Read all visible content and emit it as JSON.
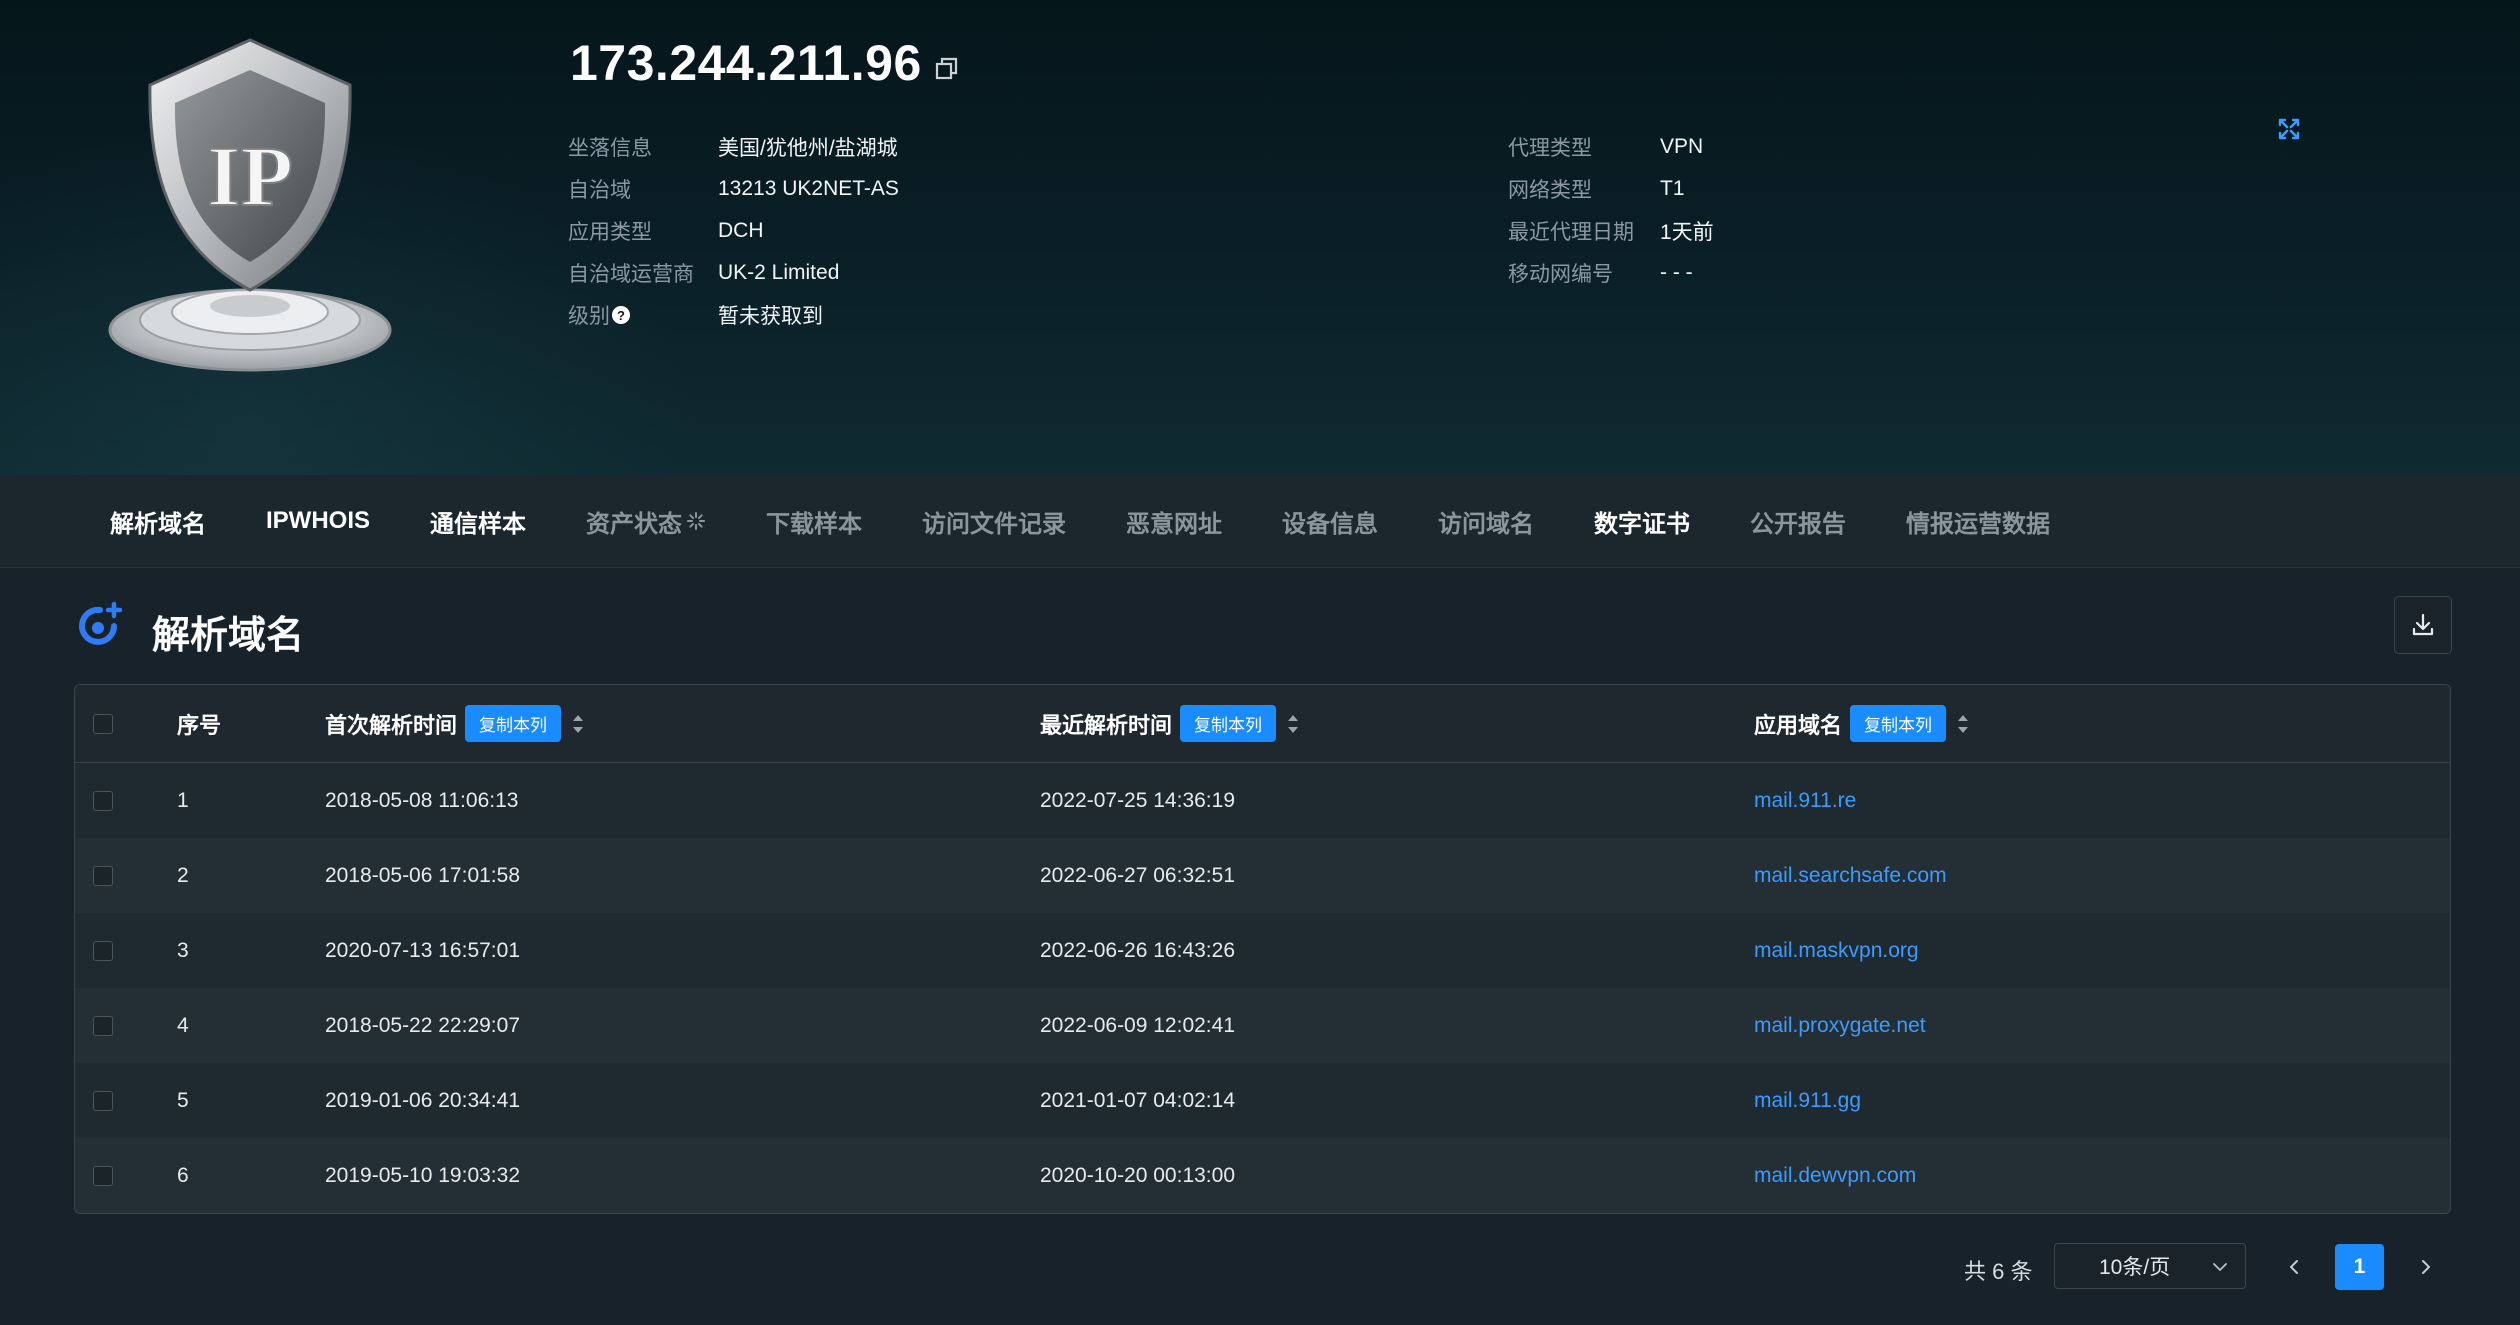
{
  "header": {
    "ip": "173.244.211.96",
    "logo_text": "IP",
    "left_info": [
      {
        "label": "坐落信息",
        "value": "美国/犹他州/盐湖城"
      },
      {
        "label": "自治域",
        "value": "13213 UK2NET-AS"
      },
      {
        "label": "应用类型",
        "value": "DCH"
      },
      {
        "label": "自治域运营商",
        "value": "UK-2 Limited"
      },
      {
        "label": "级别",
        "value": "暂未获取到"
      }
    ],
    "right_info": [
      {
        "label": "代理类型",
        "value": "VPN"
      },
      {
        "label": "网络类型",
        "value": "T1"
      },
      {
        "label": "最近代理日期",
        "value": "1天前"
      },
      {
        "label": "移动网编号",
        "value": "- - -"
      }
    ],
    "help_glyph": "?"
  },
  "tabs": [
    {
      "label": "解析域名",
      "state": "active"
    },
    {
      "label": "IPWHOIS",
      "state": "active"
    },
    {
      "label": "通信样本",
      "state": "active"
    },
    {
      "label": "资产状态",
      "state": "loading"
    },
    {
      "label": "下载样本",
      "state": "inactive"
    },
    {
      "label": "访问文件记录",
      "state": "inactive"
    },
    {
      "label": "恶意网址",
      "state": "inactive"
    },
    {
      "label": "设备信息",
      "state": "inactive"
    },
    {
      "label": "访问域名",
      "state": "inactive"
    },
    {
      "label": "数字证书",
      "state": "active"
    },
    {
      "label": "公开报告",
      "state": "inactive"
    },
    {
      "label": "情报运营数据",
      "state": "inactive"
    }
  ],
  "section": {
    "title": "解析域名"
  },
  "table": {
    "columns": {
      "seq": "序号",
      "first": "首次解析时间",
      "last": "最近解析时间",
      "domain": "应用域名",
      "copy_label": "复制本列"
    },
    "rows": [
      {
        "seq": "1",
        "first": "2018-05-08 11:06:13",
        "last": "2022-07-25 14:36:19",
        "domain": "mail.911.re"
      },
      {
        "seq": "2",
        "first": "2018-05-06 17:01:58",
        "last": "2022-06-27 06:32:51",
        "domain": "mail.searchsafe.com"
      },
      {
        "seq": "3",
        "first": "2020-07-13 16:57:01",
        "last": "2022-06-26 16:43:26",
        "domain": "mail.maskvpn.org"
      },
      {
        "seq": "4",
        "first": "2018-05-22 22:29:07",
        "last": "2022-06-09 12:02:41",
        "domain": "mail.proxygate.net"
      },
      {
        "seq": "5",
        "first": "2019-01-06 20:34:41",
        "last": "2021-01-07 04:02:14",
        "domain": "mail.911.gg"
      },
      {
        "seq": "6",
        "first": "2019-05-10 19:03:32",
        "last": "2020-10-20 00:13:00",
        "domain": "mail.dewvpn.com"
      }
    ]
  },
  "pagination": {
    "total": "共 6 条",
    "page_size": "10条/页",
    "current_page": "1"
  },
  "colors": {
    "accent": "#1a8cff",
    "link": "#3d9bff",
    "background": "#17222a"
  }
}
